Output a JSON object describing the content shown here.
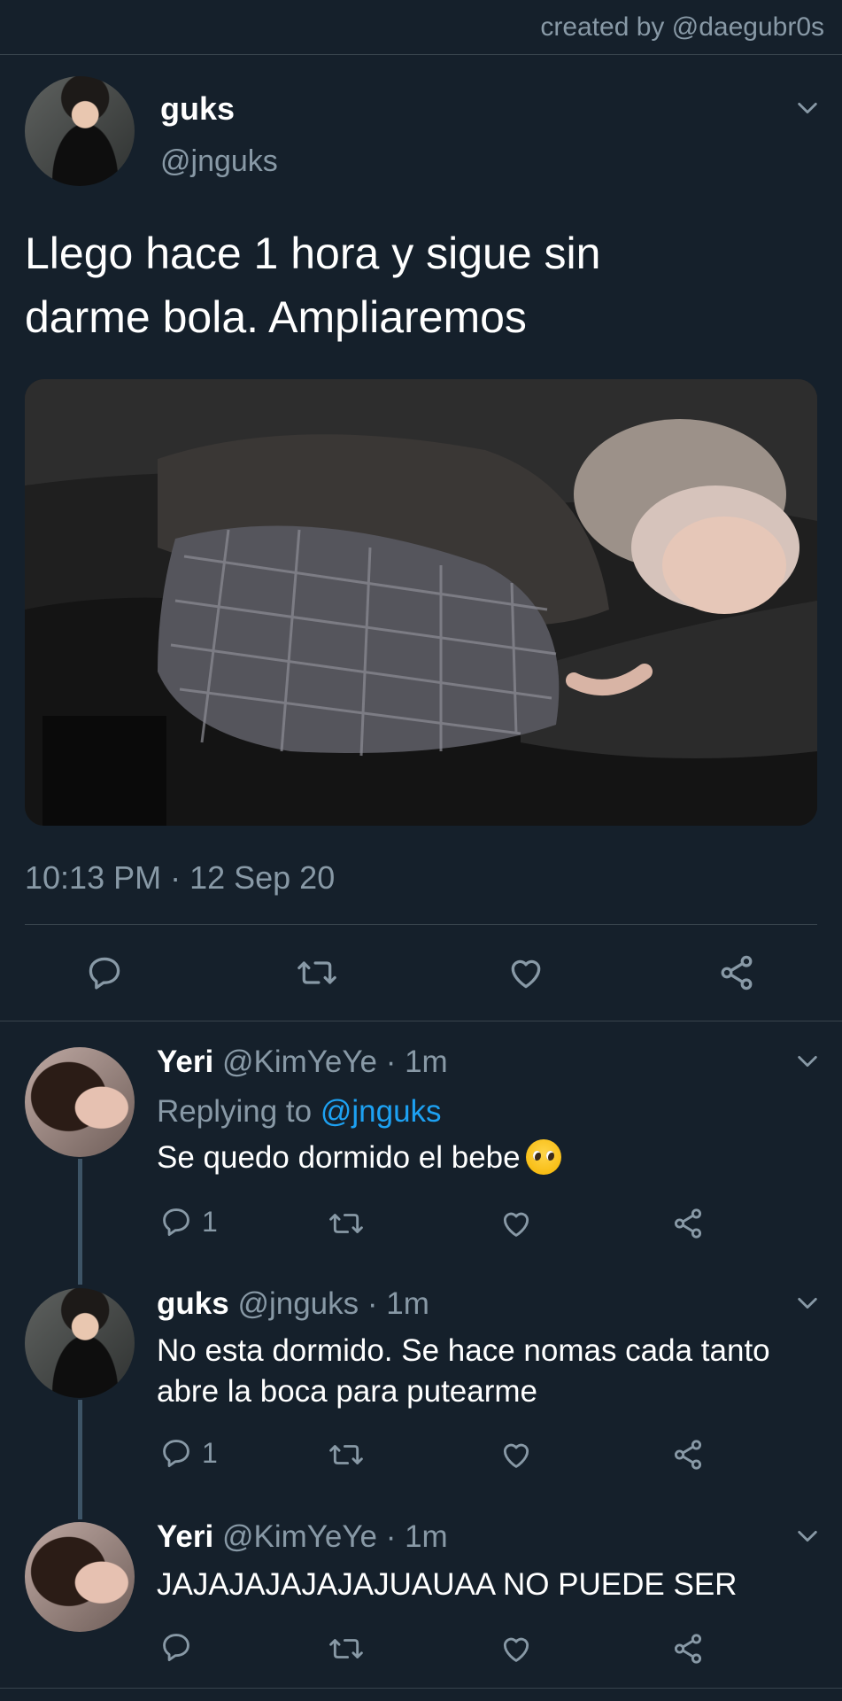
{
  "credit": "created by @daegubr0s",
  "main_tweet": {
    "name": "guks",
    "handle": "@jnguks",
    "text": "Llego hace 1 hora y sigue sin\ndarme bola. Ampliaremos",
    "timestamp": "10:13 PM · 12 Sep 20",
    "actions": [
      "reply-icon",
      "retweet-icon",
      "like-icon",
      "share-icon"
    ]
  },
  "replies": [
    {
      "name": "Yeri",
      "handle": "@KimYeYe",
      "time": "· 1m",
      "replying_prefix": "Replying to",
      "replying_to": "@jnguks",
      "text": "Se quedo dormido el bebe",
      "emoji": "pleading-face-icon",
      "reply_count": "1"
    },
    {
      "name": "guks",
      "handle": "@jnguks",
      "time": "· 1m",
      "text": "No esta dormido. Se hace nomas cada tanto abre la boca para putearme",
      "reply_count": "1"
    },
    {
      "name": "Yeri",
      "handle": "@KimYeYe",
      "time": "· 1m",
      "text": "JAJAJAJAJAJAJUAUAA NO PUEDE SER",
      "reply_count": ""
    }
  ],
  "colors": {
    "background": "#15202b",
    "secondary_text": "#8899a6",
    "link": "#1da1f2",
    "divider": "#38444d"
  }
}
